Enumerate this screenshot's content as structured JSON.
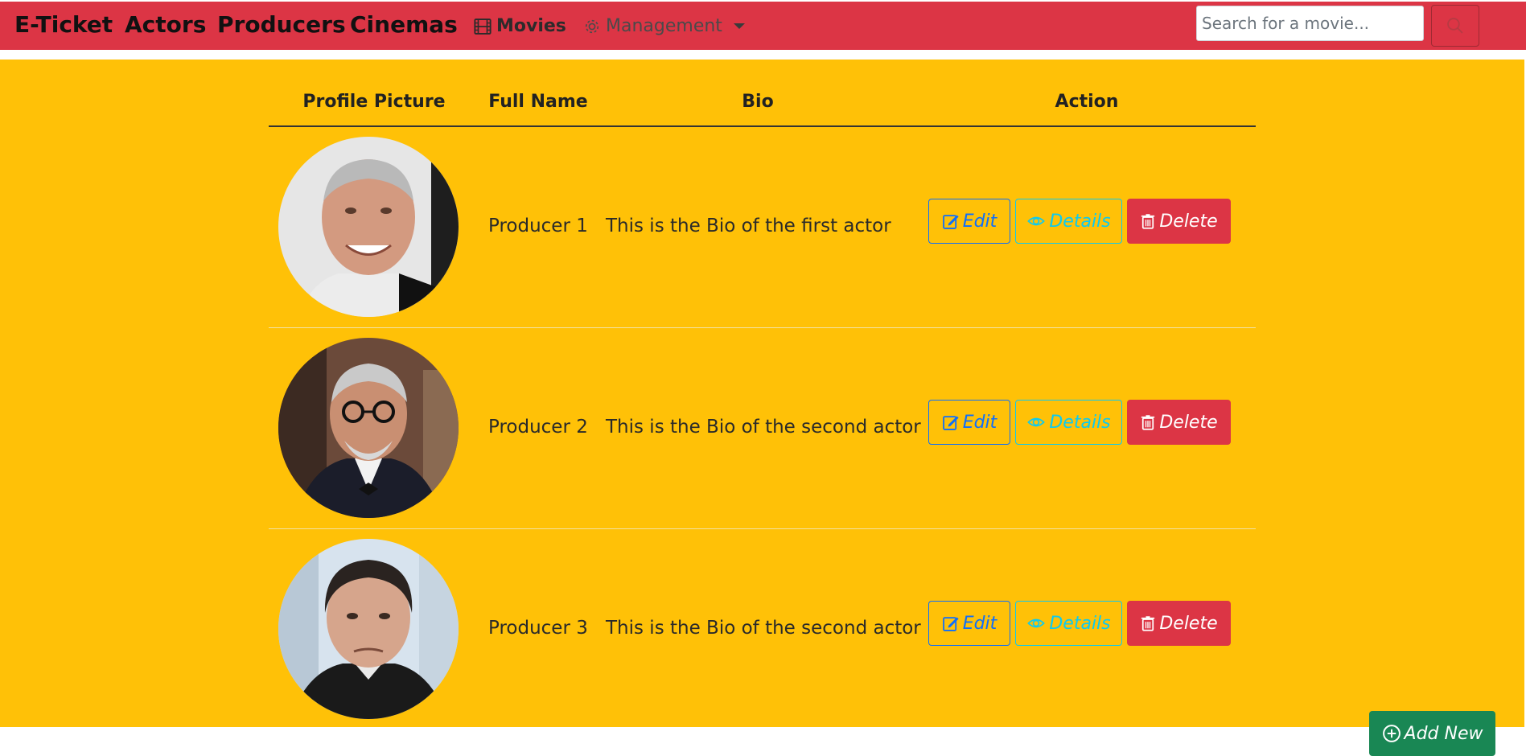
{
  "navbar": {
    "brand": "E-Ticket",
    "links": [
      "Actors",
      "Producers",
      "Cinemas"
    ],
    "movies_label": "Movies",
    "management_label": "Management",
    "search_placeholder": "Search for a movie..."
  },
  "table": {
    "headers": [
      "Profile Picture",
      "Full Name",
      "Bio",
      "Action"
    ],
    "rows": [
      {
        "full_name": "Producer 1",
        "bio": "This is the Bio of the first actor"
      },
      {
        "full_name": "Producer 2",
        "bio": "This is the Bio of the second actor"
      },
      {
        "full_name": "Producer 3",
        "bio": "This is the Bio of the second actor"
      }
    ],
    "actions": {
      "edit": "Edit",
      "details": "Details",
      "delete": "Delete"
    }
  },
  "add_new_label": "Add New",
  "colors": {
    "navbar": "#dc3545",
    "page_background": "#ffc107",
    "edit": "#0d6efd",
    "details": "#0dcaf0",
    "delete": "#dc3545",
    "add_new": "#198754"
  },
  "icons": {
    "movies": "film-icon",
    "management": "gear-icon",
    "search": "search-icon",
    "edit": "pencil-square-icon",
    "details": "eye-icon",
    "delete": "trash-icon",
    "add_new": "plus-circle-icon"
  }
}
